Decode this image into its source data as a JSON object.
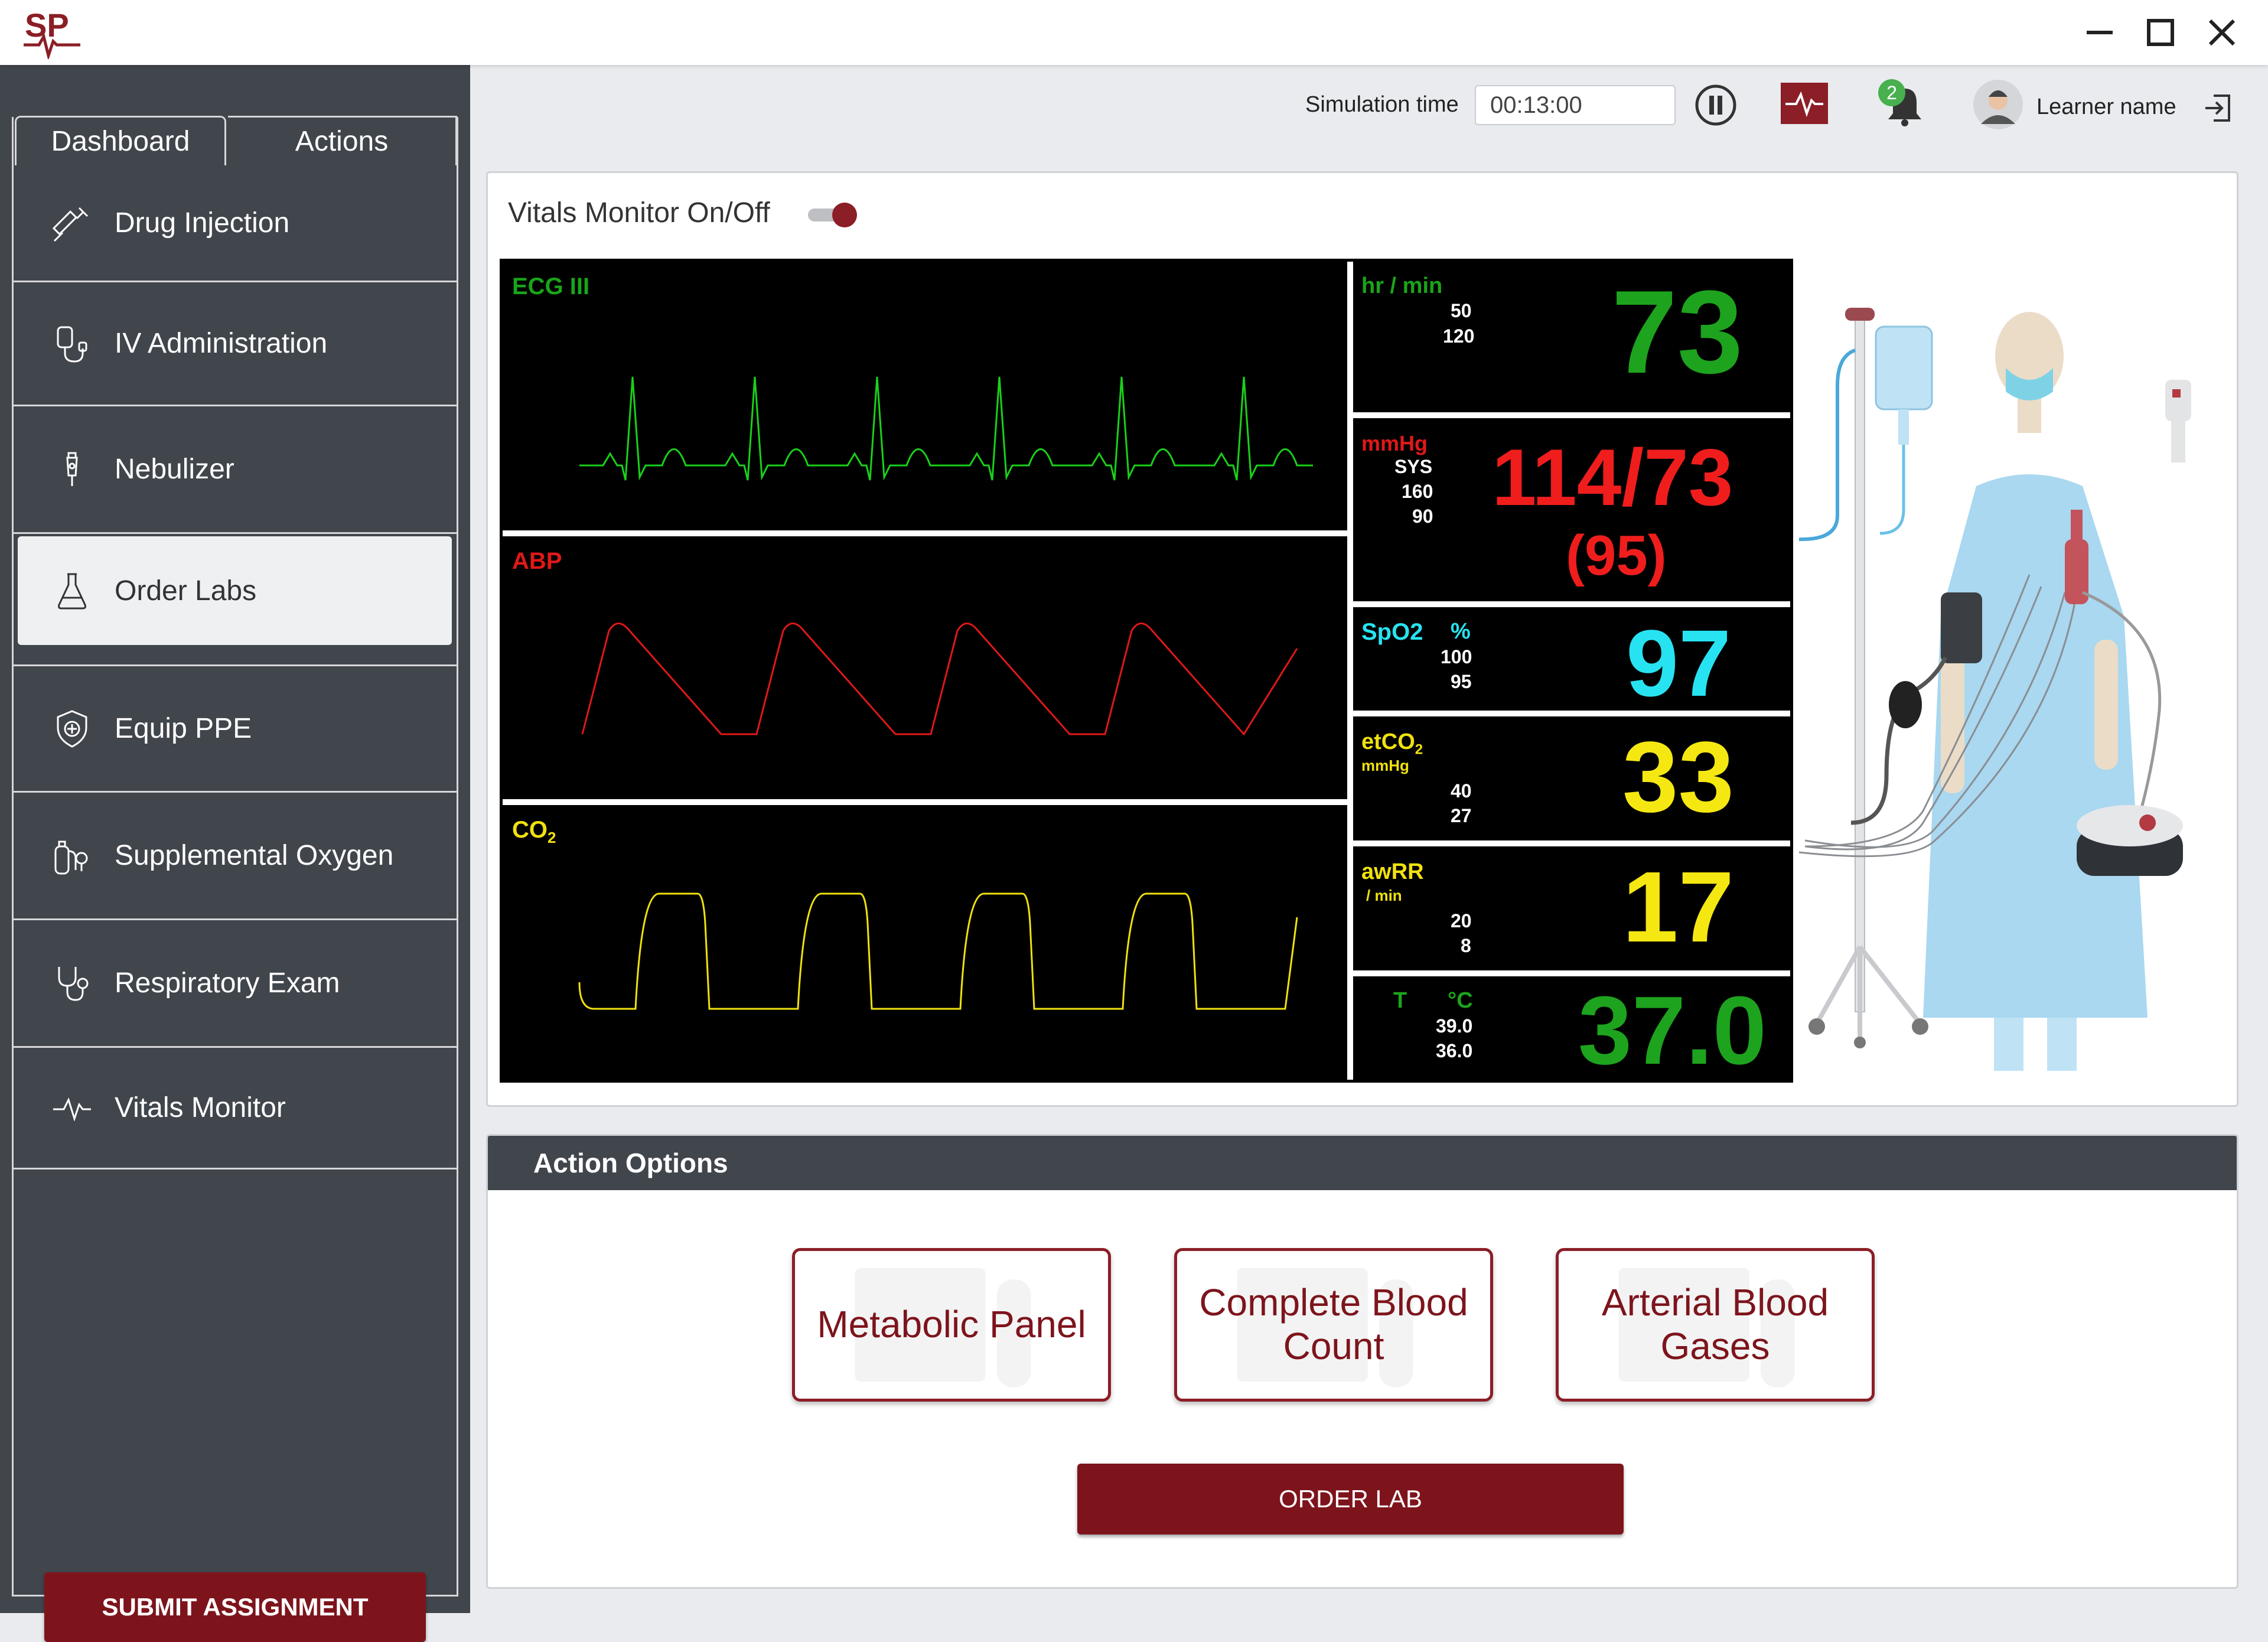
{
  "window": {
    "logo_text": "SP"
  },
  "sidebar": {
    "tabs": [
      {
        "label": "Dashboard"
      },
      {
        "label": "Actions"
      }
    ],
    "items": [
      {
        "label": "Drug Injection",
        "icon": "syringe-icon"
      },
      {
        "label": "IV Administration",
        "icon": "iv-bag-icon"
      },
      {
        "label": "Nebulizer",
        "icon": "nebulizer-icon"
      },
      {
        "label": "Order Labs",
        "icon": "flask-icon",
        "active": true
      },
      {
        "label": "Equip PPE",
        "icon": "shield-icon"
      },
      {
        "label": "Supplemental Oxygen",
        "icon": "oxygen-tank-icon"
      },
      {
        "label": "Respiratory Exam",
        "icon": "stethoscope-icon"
      },
      {
        "label": "Vitals Monitor",
        "icon": "heartbeat-icon"
      }
    ],
    "submit_label": "SUBMIT ASSIGNMENT"
  },
  "topbar": {
    "simulation_label": "Simulation time",
    "simulation_time": "00:13:00",
    "notification_count": "2",
    "user_name": "Learner name"
  },
  "vitals": {
    "toggle_label": "Vitals Monitor On/Off",
    "toggle_on": true,
    "waves": {
      "ecg": "ECG III",
      "abp": "ABP",
      "co2": "CO"
    },
    "hr": {
      "unit": "hr / min",
      "low": "50",
      "high": "120",
      "value": "73"
    },
    "bp": {
      "unit": "mmHg",
      "sub": "SYS",
      "high": "160",
      "low": "90",
      "value": "114/73",
      "mean": "(95)"
    },
    "spo2": {
      "label": "SpO2",
      "unit": "%",
      "high": "100",
      "low": "95",
      "value": "97"
    },
    "etco2": {
      "label": "etCO",
      "unit": "mmHg",
      "high": "40",
      "low": "27",
      "value": "33"
    },
    "awrr": {
      "label": "awRR",
      "unit": "/ min",
      "high": "20",
      "low": "8",
      "value": "17"
    },
    "temp": {
      "label": "T",
      "unit": "°C",
      "high": "39.0",
      "low": "36.0",
      "value": "37.0"
    }
  },
  "actions": {
    "header": "Action Options",
    "labs": [
      "Metabolic Panel",
      "Complete Blood Count",
      "Arterial Blood Gases"
    ],
    "order_label": "ORDER LAB"
  },
  "colors": {
    "accent": "#7d141c",
    "sidebar": "#41454c",
    "ecg": "#19d119",
    "abp": "#e01818",
    "co2": "#f0e10e",
    "spo2": "#27e3f2"
  }
}
